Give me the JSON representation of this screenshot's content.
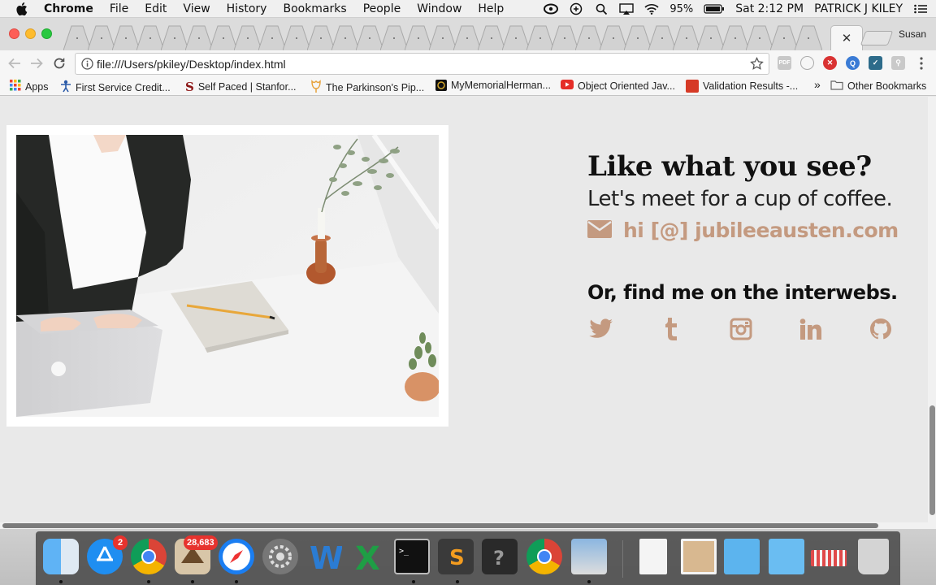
{
  "menubar": {
    "app": "Chrome",
    "items": [
      "File",
      "Edit",
      "View",
      "History",
      "Bookmarks",
      "People",
      "Window",
      "Help"
    ],
    "battery": "95%",
    "clock": "Sat 2:12 PM",
    "user": "PATRICK J KILEY"
  },
  "tabs": {
    "profile_name": "Susan",
    "close_glyph": "✕"
  },
  "toolbar": {
    "url": "file:///Users/pkiley/Desktop/index.html"
  },
  "bookmarks": {
    "items": [
      {
        "label": "Apps",
        "icon": "apps-grid-icon",
        "color": "#3d7fd6"
      },
      {
        "label": "First Service Credit...",
        "icon": "person-icon",
        "color": "#2a5aa8"
      },
      {
        "label": "Self Paced | Stanfor...",
        "icon": "stanford-s-icon",
        "color": "#8c1515"
      },
      {
        "label": "The Parkinson's Pip...",
        "icon": "tulip-icon",
        "color": "#e7a23b"
      },
      {
        "label": "MyMemorialHerman...",
        "icon": "memorial-icon",
        "color": "#222222"
      },
      {
        "label": "Object Oriented Jav...",
        "icon": "youtube-icon",
        "color": "#e52d27"
      },
      {
        "label": "Validation Results -...",
        "icon": "w3c-icon",
        "color": "#d63a26"
      }
    ],
    "overflow": "»",
    "other": "Other Bookmarks"
  },
  "page": {
    "cta_heading": "Like what you see?",
    "cta_sub": "Let's meet for a cup of coffee.",
    "email": "hi [@] jubileeausten.com",
    "social_heading": "Or, find me on the interwebs.",
    "social": [
      "twitter-icon",
      "tumblr-icon",
      "instagram-icon",
      "linkedin-icon",
      "github-icon"
    ],
    "accent_color": "#c49a80"
  },
  "dock": {
    "apps": [
      "Finder",
      "App Store",
      "Chrome",
      "Mail",
      "Safari",
      "System Preferences",
      "Word",
      "Excel",
      "Terminal",
      "Sublime Text",
      "Unknown",
      "Chrome",
      "Preview"
    ],
    "badges": {
      "app_store": "2",
      "mail": "28,683"
    },
    "items_right": [
      "XML document",
      "Photo",
      "Folder",
      "Folder",
      "Archive",
      "Trash"
    ]
  }
}
